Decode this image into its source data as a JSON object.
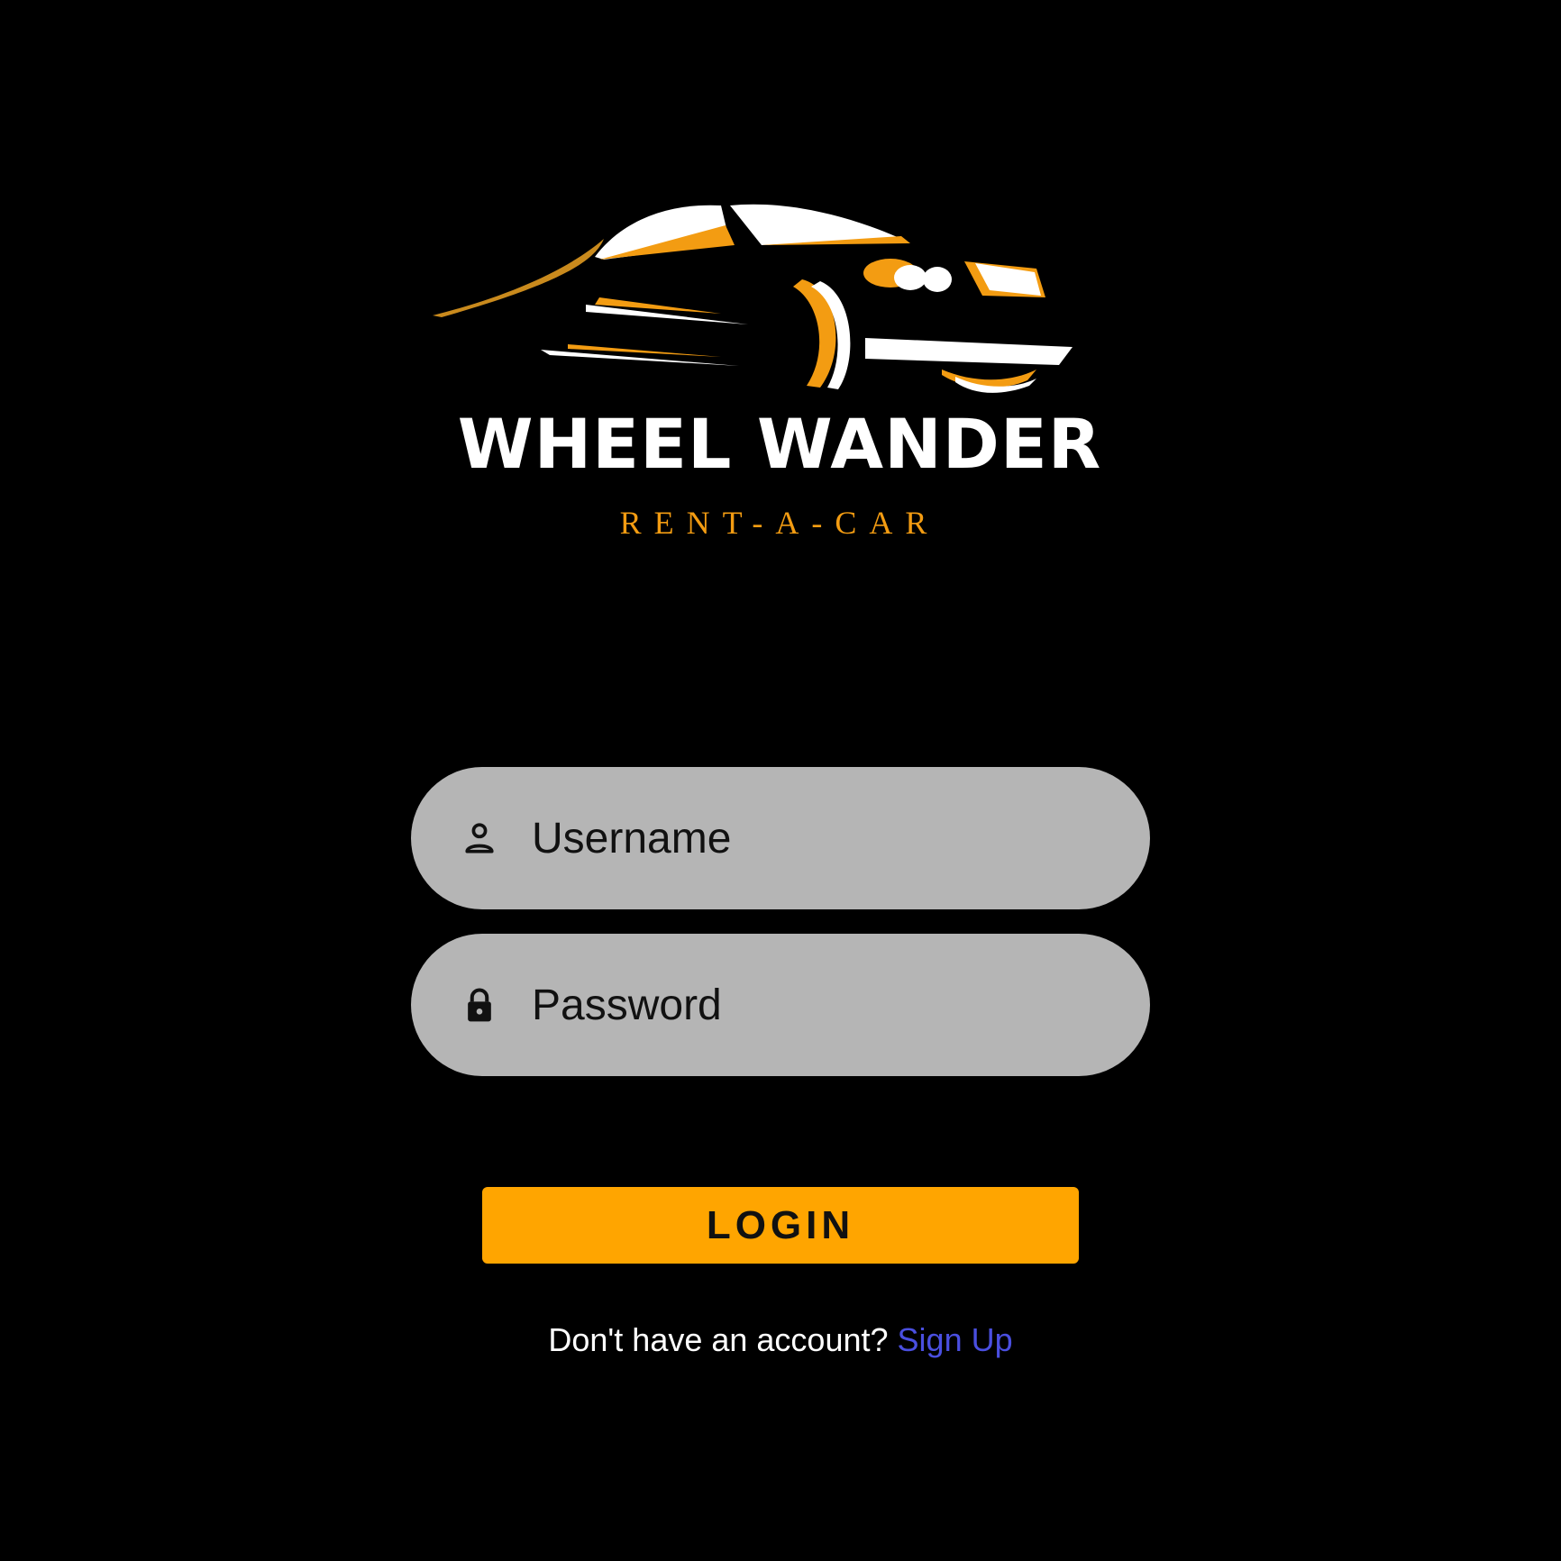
{
  "brand": {
    "title": "WHEEL WANDER",
    "subtitle": "RENT-A-CAR",
    "accent_color": "#f39c12"
  },
  "form": {
    "username": {
      "placeholder": "Username",
      "value": "",
      "icon": "person-icon"
    },
    "password": {
      "placeholder": "Password",
      "value": "",
      "icon": "lock-icon"
    },
    "field_color": "#b5b5b5"
  },
  "login_button": {
    "label": "LOGIN",
    "color": "#ffa500"
  },
  "signup": {
    "prompt": "Don't have an account?",
    "link_label": "Sign Up",
    "link_color": "#4a4fe0"
  }
}
